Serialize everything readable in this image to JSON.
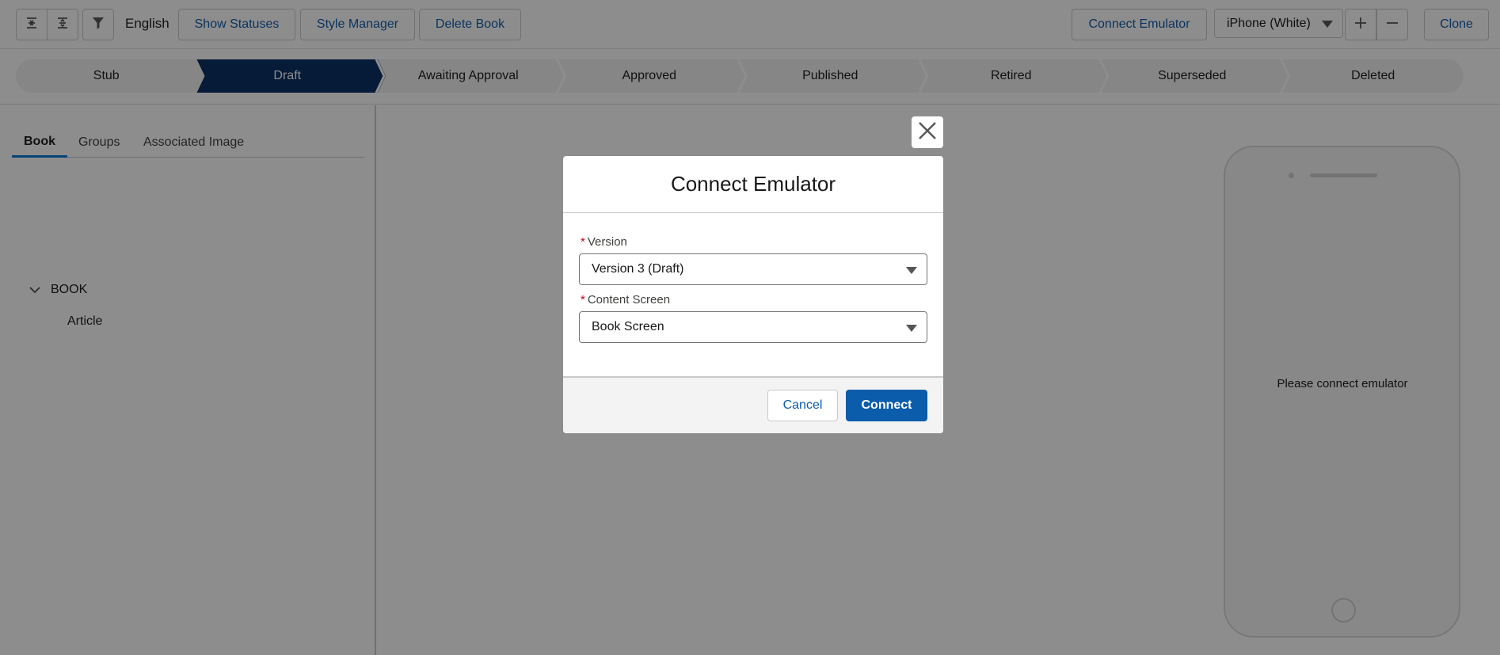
{
  "toolbar": {
    "language": "English",
    "show_statuses": "Show Statuses",
    "style_manager": "Style Manager",
    "delete_book": "Delete Book",
    "connect_emulator": "Connect Emulator",
    "device": "iPhone (White)",
    "clone": "Clone"
  },
  "path": {
    "steps": [
      "Stub",
      "Draft",
      "Awaiting Approval",
      "Approved",
      "Published",
      "Retired",
      "Superseded",
      "Deleted"
    ],
    "active_step": "Draft",
    "active_color": "#032d60",
    "inactive_color": "#f3f3f3"
  },
  "left_panel": {
    "tabs": [
      "Book",
      "Groups",
      "Associated Image"
    ],
    "active_tab": "Book",
    "tree": {
      "root": "BOOK",
      "children": [
        "Article"
      ]
    }
  },
  "emulator": {
    "message": "Please connect emulator"
  },
  "modal": {
    "title": "Connect Emulator",
    "version_label": "Version",
    "version_value": "Version 3 (Draft)",
    "content_screen_label": "Content Screen",
    "content_screen_value": "Book Screen",
    "required_marker": "*",
    "cancel": "Cancel",
    "connect": "Connect"
  },
  "colors": {
    "brand": "#0b5cab",
    "required": "#ba0517",
    "tab_underline": "#0176d3"
  },
  "icons": [
    "collapse-all-icon",
    "expand-all-icon",
    "filter-icon",
    "plus-icon",
    "minus-icon",
    "close-icon",
    "chevron-down-icon"
  ]
}
